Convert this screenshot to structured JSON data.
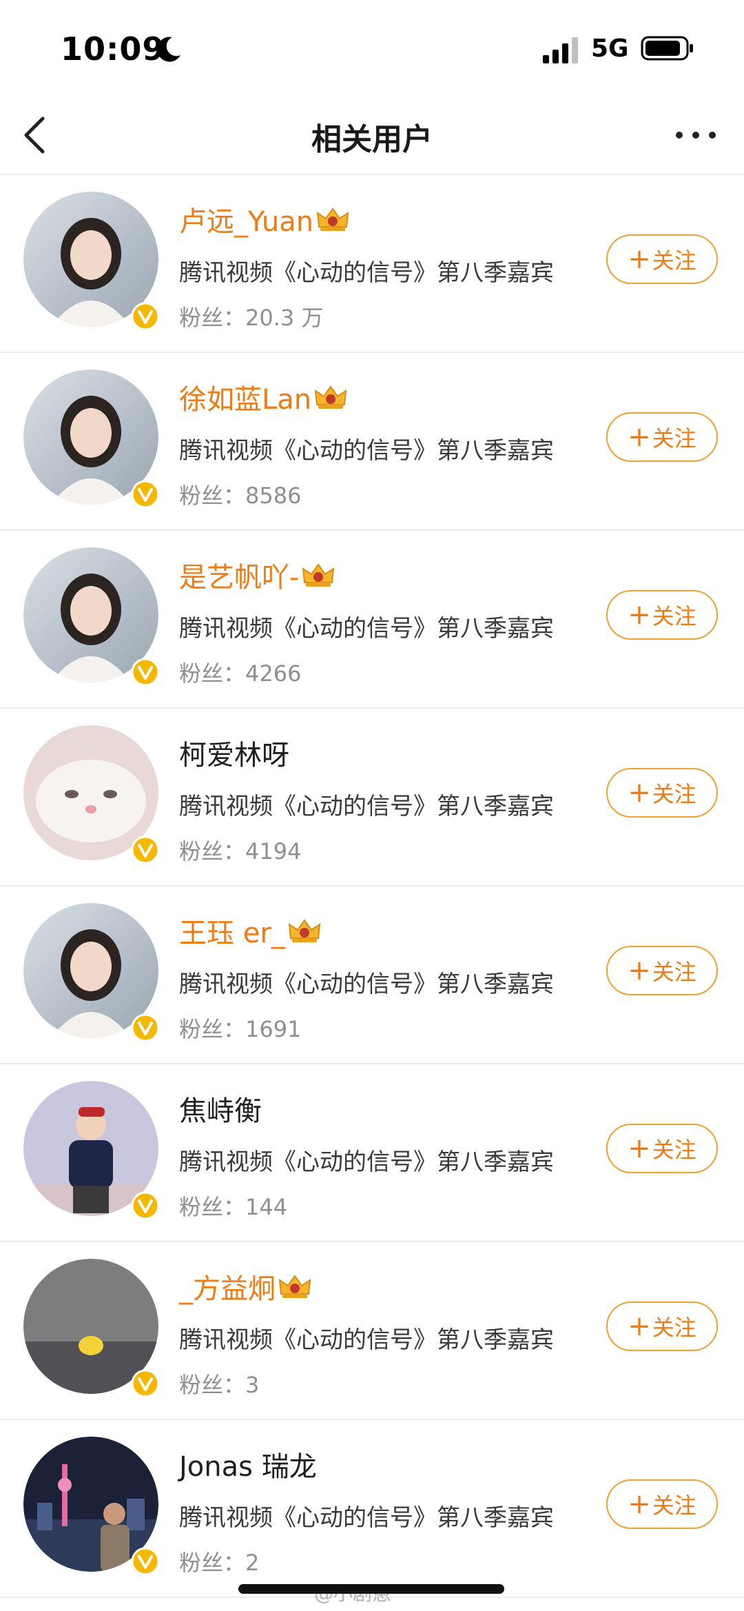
{
  "status_bar": {
    "time": "10:09",
    "network": "5G",
    "icons": [
      "moon-icon",
      "signal-icon",
      "battery-icon"
    ]
  },
  "nav": {
    "title": "相关用户",
    "icons": [
      "back-arrow-icon",
      "more-icon"
    ]
  },
  "follow_label": "关注",
  "fans_label": "粉丝：",
  "users": [
    {
      "name": "卢远_Yuan",
      "vip": true,
      "desc": "腾讯视频《心动的信号》第八季嘉宾",
      "fans": "20.3 万",
      "avatar": "woman-avatar"
    },
    {
      "name": "徐如蓝Lan",
      "vip": true,
      "desc": "腾讯视频《心动的信号》第八季嘉宾",
      "fans": "8586",
      "avatar": "woman-avatar"
    },
    {
      "name": "是艺帆吖-",
      "vip": true,
      "desc": "腾讯视频《心动的信号》第八季嘉宾",
      "fans": "4266",
      "avatar": "woman-avatar"
    },
    {
      "name": "柯爱林呀",
      "vip": false,
      "desc": "腾讯视频《心动的信号》第八季嘉宾",
      "fans": "4194",
      "avatar": "cat-avatar"
    },
    {
      "name": "王珏 er_",
      "vip": true,
      "desc": "腾讯视频《心动的信号》第八季嘉宾",
      "fans": "1691",
      "avatar": "woman-avatar"
    },
    {
      "name": "焦峙衡",
      "vip": false,
      "desc": "腾讯视频《心动的信号》第八季嘉宾",
      "fans": "144",
      "avatar": "child-avatar"
    },
    {
      "name": "_方益炯",
      "vip": true,
      "desc": "腾讯视频《心动的信号》第八季嘉宾",
      "fans": "3",
      "avatar": "room-avatar"
    },
    {
      "name": "Jonas 瑞龙",
      "vip": false,
      "desc": "腾讯视频《心动的信号》第八季嘉宾",
      "fans": "2",
      "avatar": "city-avatar"
    }
  ],
  "watermark": "@小剧崽",
  "colors": {
    "vip_name": "#f07b13",
    "follow_border": "#f0a030",
    "verified_badge": "#f5b800",
    "secondary_text": "#8f8f8f"
  }
}
